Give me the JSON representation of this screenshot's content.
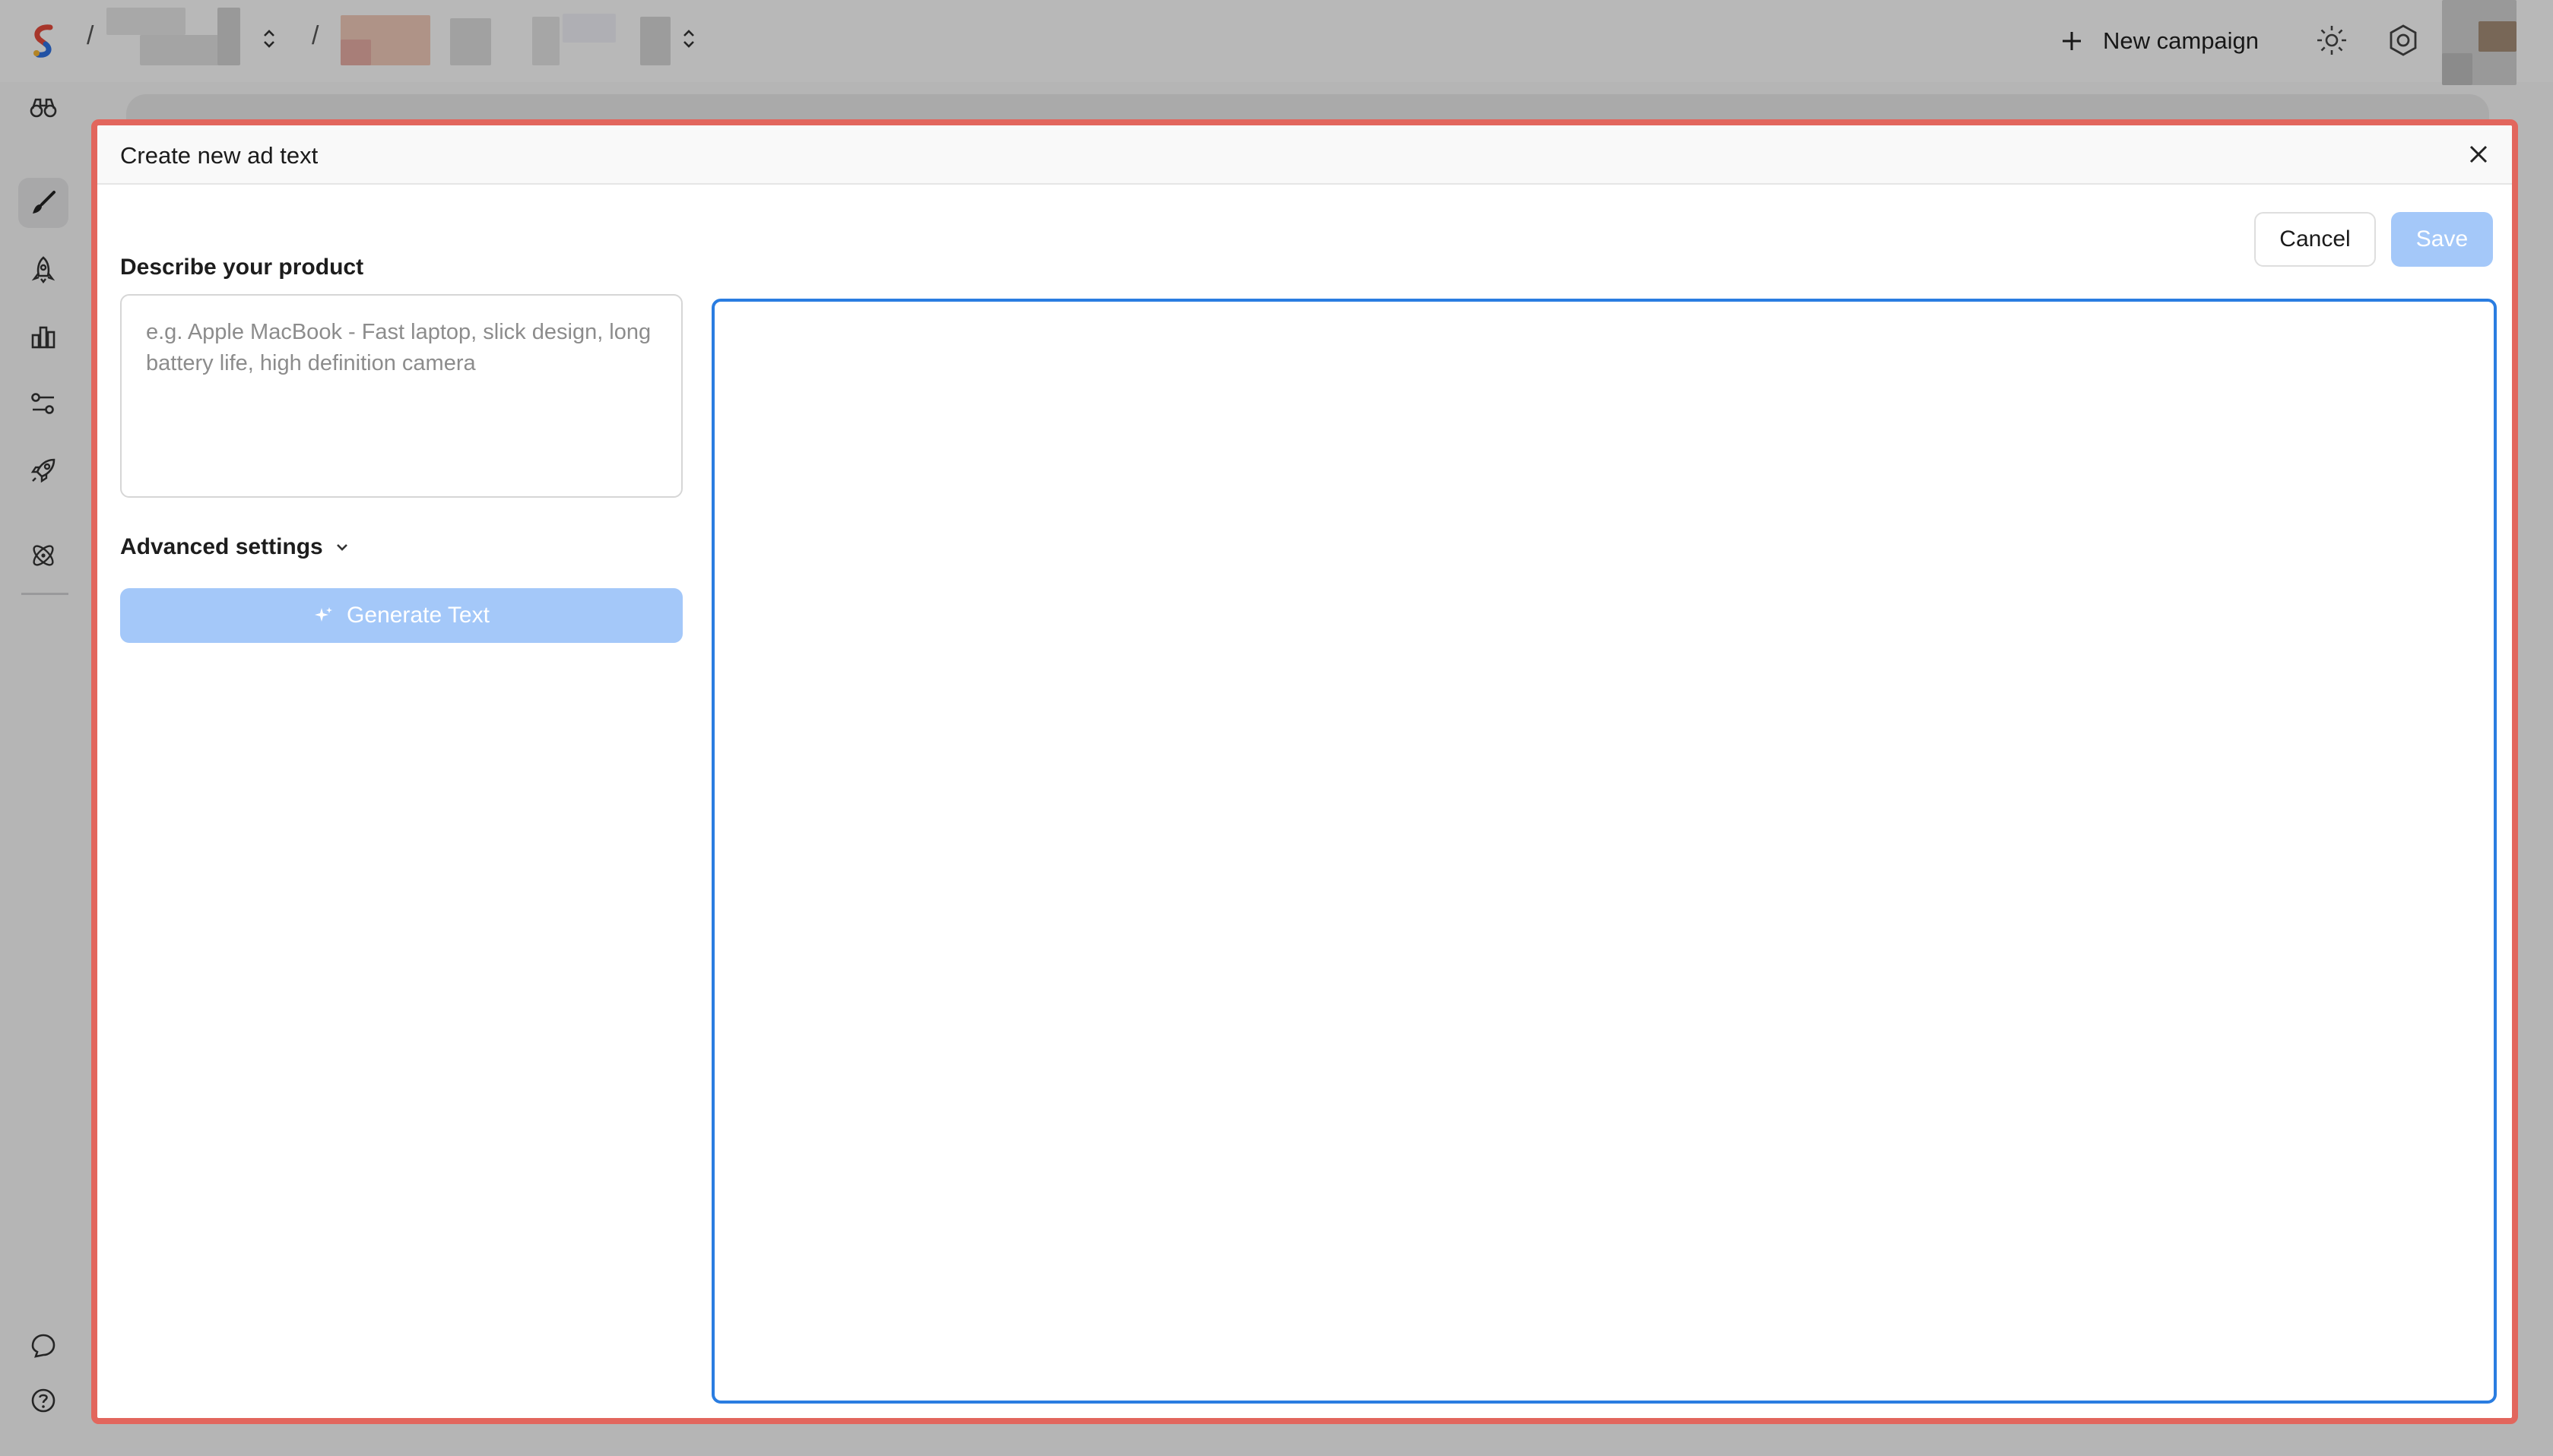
{
  "topbar": {
    "separator": "/",
    "new_campaign_label": "New campaign",
    "icons": {
      "logo": "brand-logo",
      "plus": "plus-icon",
      "theme": "sun-icon",
      "settings": "gear-icon",
      "switcher": "chevron-updown-icon"
    }
  },
  "sidebar": {
    "items": [
      {
        "name": "binoculars-icon",
        "active": false
      },
      {
        "name": "brush-icon",
        "active": true
      },
      {
        "name": "rocket-outline-icon",
        "active": false
      },
      {
        "name": "bar-chart-icon",
        "active": false
      },
      {
        "name": "sliders-icon",
        "active": false
      },
      {
        "name": "rocket-launch-icon",
        "active": false
      },
      {
        "name": "atom-icon",
        "active": false
      }
    ],
    "bottom_items": [
      {
        "name": "chat-icon"
      },
      {
        "name": "help-icon"
      }
    ]
  },
  "modal": {
    "title": "Create new ad text",
    "close_icon": "close-icon",
    "cancel_label": "Cancel",
    "save_label": "Save",
    "product_label": "Describe your product",
    "product_placeholder": "e.g. Apple MacBook - Fast laptop, slick design, long battery life, high definition camera",
    "product_value": "",
    "advanced_label": "Advanced settings",
    "generate_label": "Generate Text",
    "editor_value": ""
  },
  "colors": {
    "accent": "#2a7de1",
    "disabled_button": "#a4c8f9",
    "modal_border": "#e2665d"
  }
}
